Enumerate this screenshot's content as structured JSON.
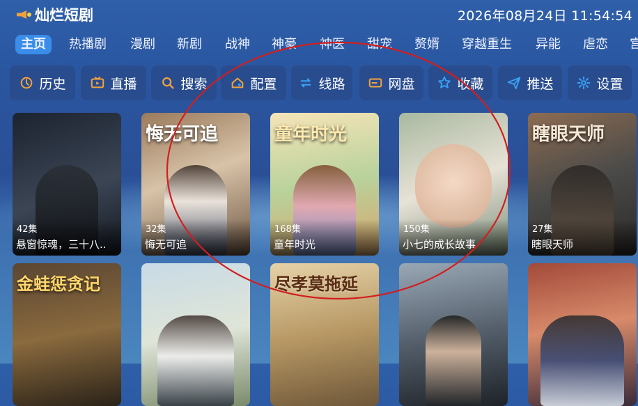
{
  "header": {
    "app_title": "灿烂短剧",
    "datetime": "2026年08月24日 11:54:54"
  },
  "tabs": [
    "主页",
    "热播剧",
    "漫剧",
    "新剧",
    "战神",
    "神豪",
    "神医",
    "甜宠",
    "赘婿",
    "穿越重生",
    "异能",
    "虐恋",
    "宫"
  ],
  "active_tab": "主页",
  "actions": [
    {
      "label": "历史",
      "icon": "history-icon",
      "color": "#f2a23a"
    },
    {
      "label": "直播",
      "icon": "tv-icon",
      "color": "#f2a23a"
    },
    {
      "label": "搜索",
      "icon": "search-icon",
      "color": "#f2a23a"
    },
    {
      "label": "配置",
      "icon": "home-config-icon",
      "color": "#f2a23a"
    },
    {
      "label": "线路",
      "icon": "route-icon",
      "color": "#3aa3f2"
    },
    {
      "label": "网盘",
      "icon": "card-icon",
      "color": "#f2a23a"
    },
    {
      "label": "收藏",
      "icon": "star-icon",
      "color": "#3aa3f2"
    },
    {
      "label": "推送",
      "icon": "send-icon",
      "color": "#3aa3f2"
    },
    {
      "label": "设置",
      "icon": "gear-icon",
      "color": "#3aa3f2"
    }
  ],
  "cards_row1": [
    {
      "episodes": "42集",
      "name": "悬窗惊魂，三十八..",
      "poster_text": ""
    },
    {
      "episodes": "32集",
      "name": "悔无可追",
      "poster_text": "悔无可追"
    },
    {
      "episodes": "168集",
      "name": "童年时光",
      "poster_text": "童年时光"
    },
    {
      "episodes": "150集",
      "name": "小七的成长故事",
      "poster_text": ""
    },
    {
      "episodes": "27集",
      "name": "瞎眼天师",
      "poster_text": "瞎眼天师"
    }
  ],
  "cards_row2": [
    {
      "poster_text": "金蛙惩贪记"
    },
    {
      "poster_text": ""
    },
    {
      "poster_text": "尽孝莫拖延"
    },
    {
      "poster_text": ""
    },
    {
      "poster_text": ""
    }
  ],
  "colors": {
    "accent": "#3a8de9",
    "annotation": "#d11f1f"
  }
}
